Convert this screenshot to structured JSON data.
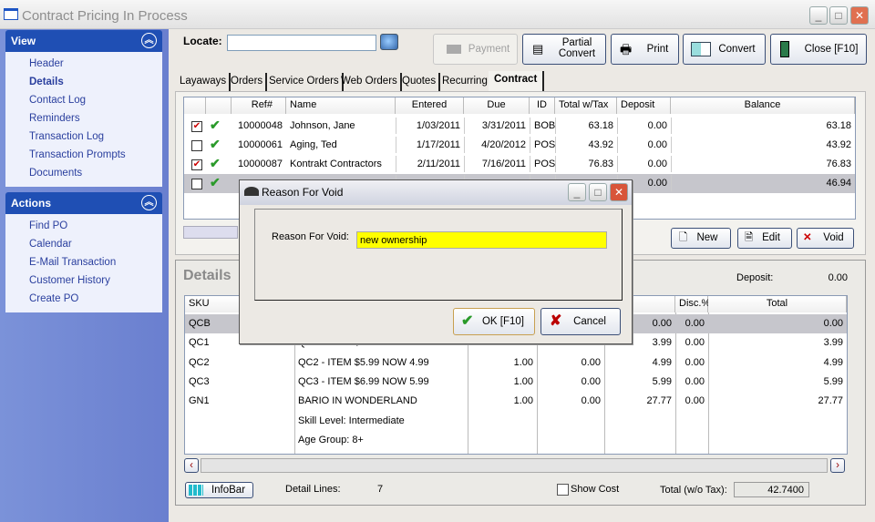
{
  "window": {
    "title": "Contract Pricing In Process",
    "min": "_",
    "max": "□",
    "close": "✕"
  },
  "sidebar": {
    "view": {
      "title": "View",
      "items": [
        "Header",
        "Details",
        "Contact Log",
        "Reminders",
        "Transaction Log",
        "Transaction Prompts",
        "Documents"
      ],
      "active": "Details"
    },
    "actions": {
      "title": "Actions",
      "items": [
        "Find PO",
        "Calendar",
        "E-Mail Transaction",
        "Customer History",
        "Create PO"
      ]
    }
  },
  "toolbar": {
    "locate_label": "Locate:",
    "locate_value": "",
    "payment": "Payment",
    "partial_convert_1": "Partial",
    "partial_convert_2": "Convert",
    "print": "Print",
    "convert": "Convert",
    "close": "Close [F10]"
  },
  "tabs": [
    "Layaways",
    "Orders",
    "Service Orders",
    "Web Orders",
    "Quotes",
    "Recurring",
    "Contract"
  ],
  "active_tab": "Contract",
  "orders": {
    "columns": [
      "Ref#",
      "Name",
      "Entered",
      "Due",
      "ID",
      "Total w/Tax",
      "Deposit",
      "Balance"
    ],
    "rows": [
      {
        "checked": true,
        "ref": "10000048",
        "name": "Johnson, Jane",
        "entered": "1/03/2011",
        "due": "3/31/2011",
        "id": "BOB",
        "total": "63.18",
        "deposit": "0.00",
        "balance": "63.18"
      },
      {
        "checked": false,
        "ref": "10000061",
        "name": "Aging, Ted",
        "entered": "1/17/2011",
        "due": "4/20/2012",
        "id": "POS",
        "total": "43.92",
        "deposit": "0.00",
        "balance": "43.92"
      },
      {
        "checked": true,
        "ref": "10000087",
        "name": "Kontrakt Contractors",
        "entered": "2/11/2011",
        "due": "7/16/2011",
        "id": "POS",
        "total": "76.83",
        "deposit": "0.00",
        "balance": "76.83"
      },
      {
        "checked": false,
        "ref": "",
        "name": "",
        "entered": "",
        "due": "",
        "id": "",
        "total": "",
        "deposit": "0.00",
        "balance": "46.94"
      }
    ],
    "new": "New",
    "edit": "Edit",
    "void": "Void"
  },
  "details": {
    "title": "Details",
    "deposit_label": "Deposit:",
    "deposit_value": "0.00",
    "columns": [
      "SKU",
      "",
      "",
      "",
      "Price",
      "Disc.%",
      "Total"
    ],
    "rows": [
      [
        "QCB",
        "",
        "",
        "",
        "0.00",
        "0.00",
        "0.00"
      ],
      [
        "QC1",
        "QC1 - ITEM $4.99 NOW 3.99",
        "1.00",
        "0.00",
        "3.99",
        "0.00",
        "3.99"
      ],
      [
        "QC2",
        "QC2 - ITEM $5.99 NOW 4.99",
        "1.00",
        "0.00",
        "4.99",
        "0.00",
        "4.99"
      ],
      [
        "QC3",
        "QC3 - ITEM $6.99 NOW 5.99",
        "1.00",
        "0.00",
        "5.99",
        "0.00",
        "5.99"
      ],
      [
        "GN1",
        "BARIO IN WONDERLAND",
        "1.00",
        "0.00",
        "27.77",
        "0.00",
        "27.77"
      ],
      [
        "",
        "Skill Level: Intermediate",
        "",
        "",
        "",
        "",
        ""
      ],
      [
        "",
        "Age Group: 8+",
        "",
        "",
        "",
        "",
        ""
      ]
    ],
    "infobar": "InfoBar",
    "detail_lines_label": "Detail Lines:",
    "detail_lines": "7",
    "show_cost": "Show Cost",
    "total_label": "Total (w/o Tax):",
    "total_value": "42.7400"
  },
  "dialog": {
    "title": "Reason For Void",
    "label": "Reason For Void:",
    "value": "new ownership",
    "ok": "OK [F10]",
    "cancel": "Cancel",
    "input_bg": "#ffff00"
  }
}
